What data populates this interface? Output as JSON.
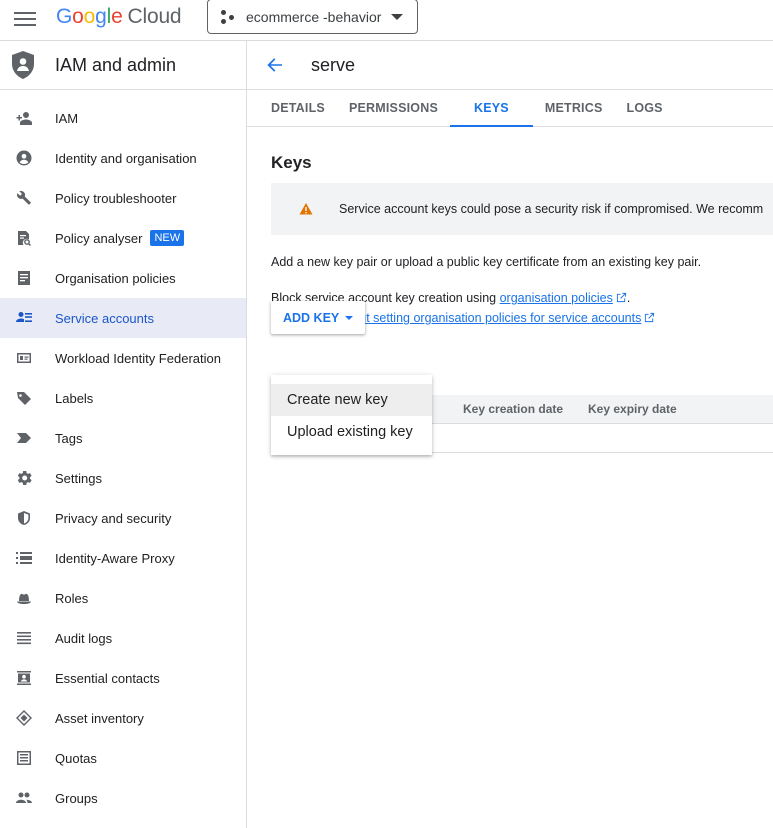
{
  "header": {
    "logo_google": "Google",
    "logo_cloud": "Cloud",
    "project_name": "ecommerce -behavior"
  },
  "sidebar": {
    "title": "IAM and admin",
    "items": [
      {
        "label": "IAM",
        "icon": "person-add-icon"
      },
      {
        "label": "Identity and organisation",
        "icon": "account-circle-icon"
      },
      {
        "label": "Policy troubleshooter",
        "icon": "wrench-icon"
      },
      {
        "label": "Policy analyser",
        "icon": "policy-analyser-icon",
        "badge": "NEW"
      },
      {
        "label": "Organisation policies",
        "icon": "document-icon"
      },
      {
        "label": "Service accounts",
        "icon": "service-account-icon",
        "active": true
      },
      {
        "label": "Workload Identity Federation",
        "icon": "id-card-icon"
      },
      {
        "label": "Labels",
        "icon": "label-icon"
      },
      {
        "label": "Tags",
        "icon": "tag-icon"
      },
      {
        "label": "Settings",
        "icon": "gear-icon"
      },
      {
        "label": "Privacy and security",
        "icon": "shield-icon"
      },
      {
        "label": "Identity-Aware Proxy",
        "icon": "proxy-icon"
      },
      {
        "label": "Roles",
        "icon": "hat-icon"
      },
      {
        "label": "Audit logs",
        "icon": "list-icon"
      },
      {
        "label": "Essential contacts",
        "icon": "contacts-icon"
      },
      {
        "label": "Asset inventory",
        "icon": "layers-icon"
      },
      {
        "label": "Quotas",
        "icon": "quota-icon"
      },
      {
        "label": "Groups",
        "icon": "group-icon"
      }
    ]
  },
  "main": {
    "title": "serve",
    "tabs": [
      {
        "label": "DETAILS"
      },
      {
        "label": "PERMISSIONS"
      },
      {
        "label": "KEYS",
        "active": true
      },
      {
        "label": "METRICS"
      },
      {
        "label": "LOGS"
      }
    ],
    "section_title": "Keys",
    "warning": "Service account keys could pose a security risk if compromised. We recomm",
    "intro": "Add a new key pair or upload a public key certificate from an existing key pair.",
    "block_text": "Block service account key creation using",
    "block_link": "organisation policies",
    "block_period": ".",
    "learn_link": "Learn more about setting organisation policies for service accounts",
    "add_key": "ADD KEY",
    "table_headers": [
      "Key creation date",
      "Key expiry date"
    ],
    "menu": [
      "Create new key",
      "Upload existing key"
    ]
  },
  "colors": {
    "accent": "#1a73e8",
    "active_bg": "#e8eaf6",
    "warning": "#e37400"
  }
}
